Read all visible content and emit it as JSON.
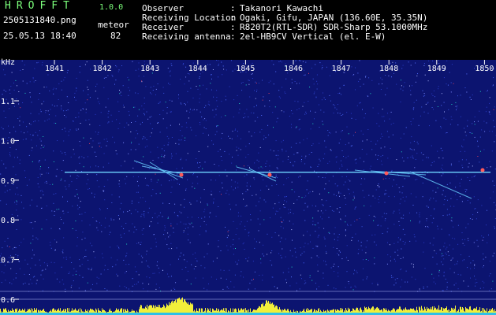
{
  "header": {
    "app_name": "HROFFT",
    "version": "1.0.0",
    "file_name": "2505131840.png",
    "mode": "meteor",
    "datetime": "25.05.13 18:40",
    "count": "82",
    "info": [
      {
        "label": "Observer",
        "value": "Takanori Kawachi"
      },
      {
        "label": "Receiving Location",
        "value": "Ogaki, Gifu, JAPAN (136.60E, 35.35N)"
      },
      {
        "label": "Receiver",
        "value": "R820T2(RTL-SDR) SDR-Sharp 53.1000MHz"
      },
      {
        "label": "Receiving antenna",
        "value": "2el-HB9CV Vertical (el. E-W)"
      }
    ],
    "separator": ":"
  },
  "spectrogram": {
    "freq_unit": "kHz",
    "x_ticks": [
      "1841",
      "1842",
      "1843",
      "1844",
      "1845",
      "1846",
      "1847",
      "1848",
      "1849",
      "1850"
    ],
    "y_ticks": [
      "1.1",
      "1.0",
      "0.9",
      "0.8",
      "0.7",
      "0.6"
    ],
    "y_tick_values": [
      1.1,
      1.0,
      0.9,
      0.8,
      0.7,
      0.6
    ],
    "y_range": [
      0.58,
      1.17
    ],
    "x_range": [
      1840.3,
      1850.1
    ],
    "carrier_khz": 0.92,
    "background_color": "#0c1470",
    "trace_color": "#6fd6ff",
    "bar_color": "#f2ef3a"
  }
}
